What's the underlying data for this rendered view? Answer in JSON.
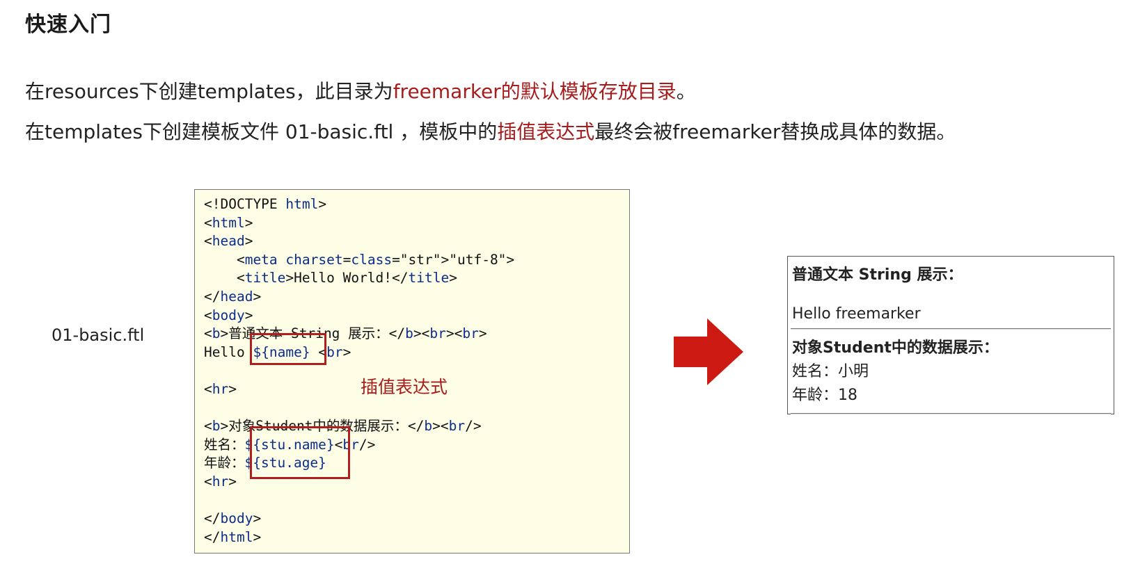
{
  "heading": "快速入门",
  "para1": {
    "before": "在resources下创建templates，此目录为",
    "highlight": "freemarker的默认模板存放目录",
    "after": "。"
  },
  "para2": {
    "before": "在templates下创建模板文件 01-basic.ftl ，模板中的",
    "highlight": "插值表达式",
    "after": "最终会被freemarker替换成具体的数据。"
  },
  "file_label": "01-basic.ftl",
  "code": {
    "lines": [
      "<!DOCTYPE html>",
      "<html>",
      "<head>",
      "    <meta charset=\"utf-8\">",
      "    <title>Hello World!</title>",
      "</head>",
      "<body>",
      "<b>普通文本 String 展示：</b><br><br>",
      "Hello ${name} <br>",
      "",
      "<hr>",
      "",
      "<b>对象Student中的数据展示：</b><br/>",
      "姓名：${stu.name}<br/>",
      "年龄：${stu.age}",
      "<hr>",
      "",
      "</body>",
      "</html>"
    ]
  },
  "interp_label": "插值表达式",
  "arrow_color": "#cc1a12",
  "result": {
    "title": "普通文本 String 展示：",
    "greeting": "Hello freemarker",
    "subtitle": "对象Student中的数据展示：",
    "name_line": "姓名：小明",
    "age_line": "年龄：18"
  }
}
